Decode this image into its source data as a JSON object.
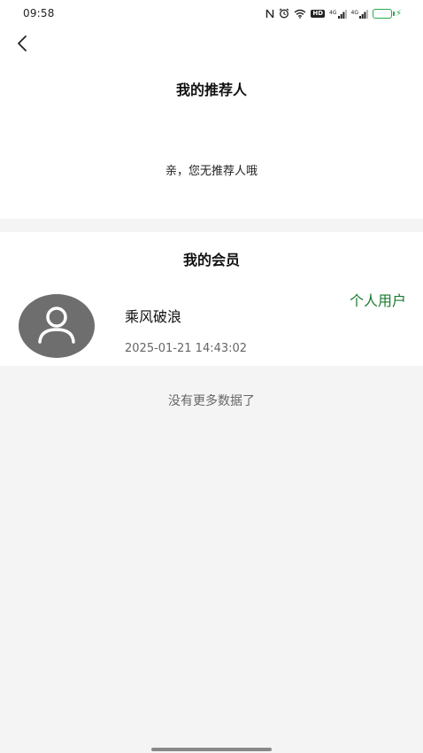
{
  "status_bar": {
    "time": "09:58",
    "icons": [
      "nfc-icon",
      "alarm-icon",
      "wifi-icon",
      "hd-icon",
      "signal-icon",
      "signal-icon",
      "battery-icon"
    ],
    "hd_label": "HD",
    "signal1_label": "4G",
    "signal2_label": "4G",
    "battery_level": 0.7,
    "battery_color": "#2aa84a"
  },
  "header": {
    "back_icon": "chevron-left-icon"
  },
  "referrer": {
    "title": "我的推荐人",
    "empty_text": "亲，您无推荐人哦"
  },
  "members": {
    "title": "我的会员",
    "items": [
      {
        "avatar_icon": "user-icon",
        "name": "乘风破浪",
        "time": "2025-01-21 14:43:02",
        "badge": "个人用户"
      }
    ]
  },
  "footer": {
    "no_more_text": "没有更多数据了"
  },
  "colors": {
    "accent_green": "#1a7a2e",
    "background": "#f4f4f4",
    "panel": "#ffffff",
    "avatar_bg": "#6e6e6e"
  }
}
